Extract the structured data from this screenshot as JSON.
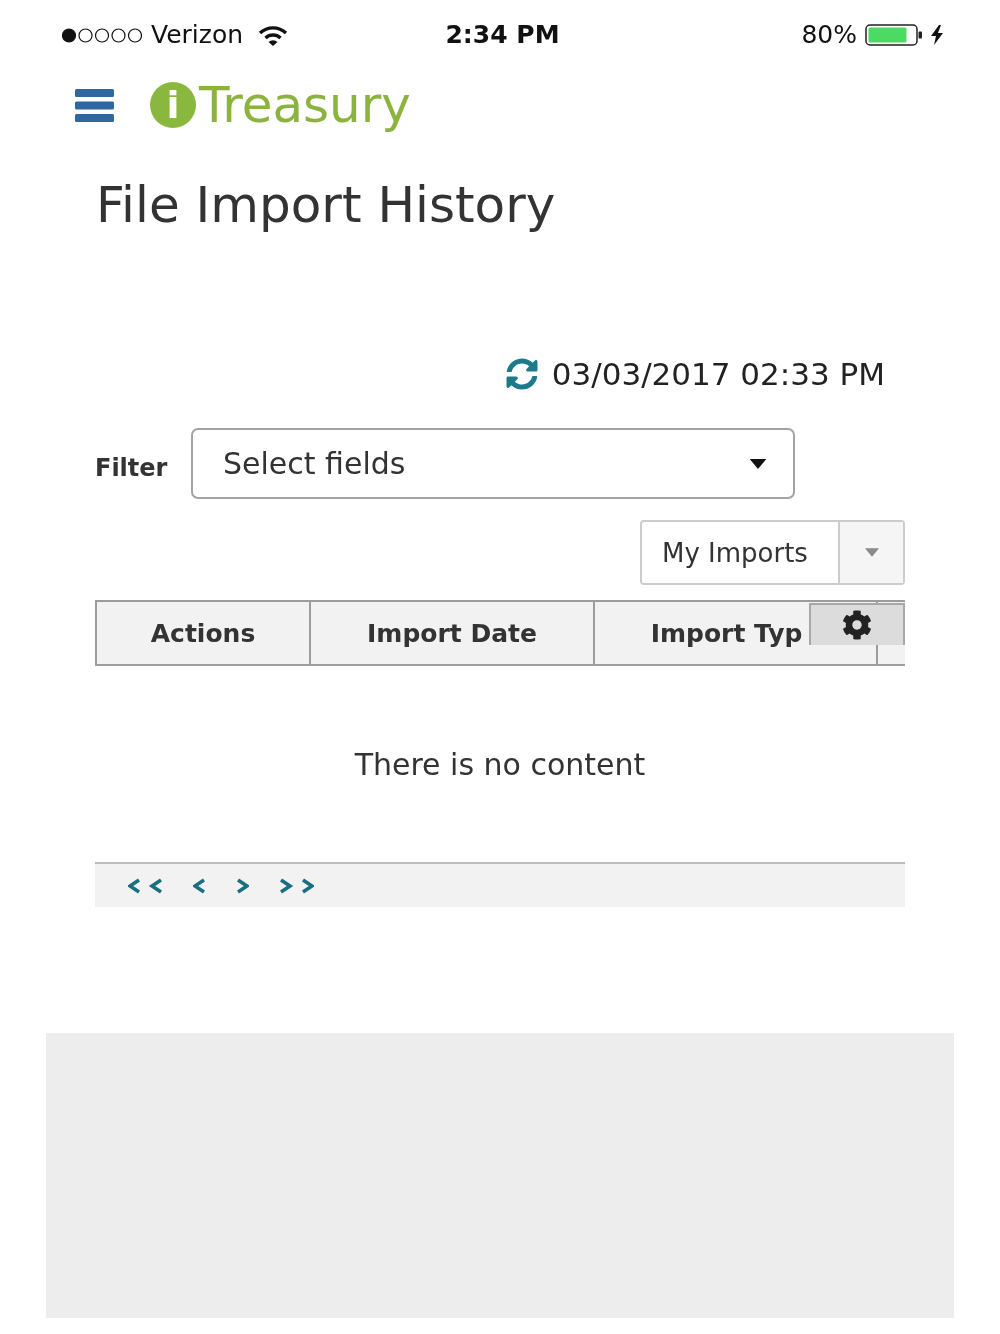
{
  "status_bar": {
    "carrier": "Verizon",
    "time": "2:34 PM",
    "battery": "80%"
  },
  "header": {
    "logo_mark": "i",
    "logo_text": "Treasury"
  },
  "page_title": "File Import History",
  "last_refreshed": "03/03/2017 02:33 PM",
  "filter": {
    "label": "Filter",
    "placeholder": "Select fields"
  },
  "scope_select": {
    "value": "My Imports"
  },
  "table": {
    "columns": [
      "Actions",
      "Import Date",
      "Import Typ"
    ],
    "empty_message": "There is no content"
  }
}
